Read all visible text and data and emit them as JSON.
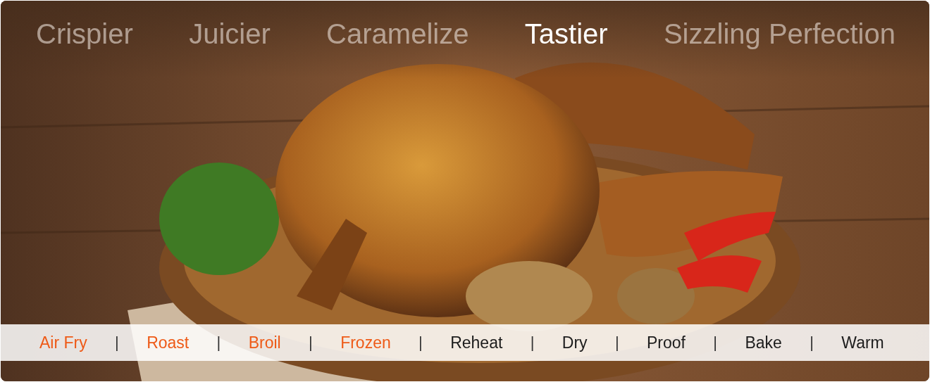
{
  "headlines": [
    {
      "label": "Crispier",
      "selected": false
    },
    {
      "label": "Juicier",
      "selected": false
    },
    {
      "label": "Caramelize",
      "selected": false
    },
    {
      "label": "Tastier",
      "selected": true
    },
    {
      "label": "Sizzling Perfection",
      "selected": false
    }
  ],
  "hero_image": {
    "kind": "picture"
  },
  "modes": [
    {
      "label": "Air Fry",
      "highlighted": true
    },
    {
      "label": "Roast",
      "highlighted": true
    },
    {
      "label": "Broil",
      "highlighted": true
    },
    {
      "label": "Frozen",
      "highlighted": true
    },
    {
      "label": "Reheat",
      "highlighted": false
    },
    {
      "label": "Dry",
      "highlighted": false
    },
    {
      "label": "Proof",
      "highlighted": false
    },
    {
      "label": "Bake",
      "highlighted": false
    },
    {
      "label": "Warm",
      "highlighted": false
    }
  ],
  "separators": [
    "|",
    "|",
    "|",
    "|",
    "|",
    "|",
    "|",
    "|"
  ]
}
